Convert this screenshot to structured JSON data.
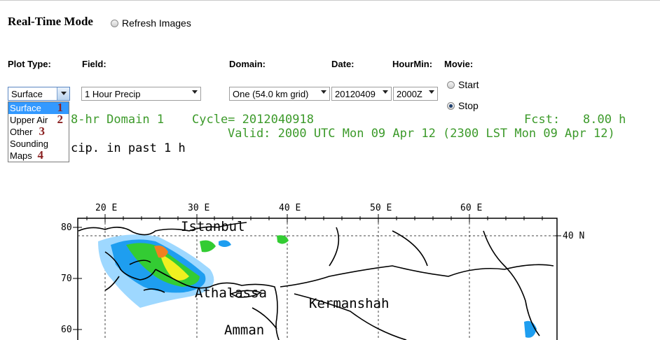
{
  "header": {
    "title": "Real-Time Mode",
    "refresh_label": "Refresh Images"
  },
  "labels": {
    "plot_type": "Plot Type:",
    "field": "Field:",
    "domain": "Domain:",
    "date": "Date:",
    "hourmin": "HourMin:",
    "movie": "Movie:"
  },
  "controls": {
    "plot_type": {
      "value": "Surface",
      "options": [
        "Surface",
        "Upper Air",
        "Other",
        "Sounding",
        "Maps"
      ],
      "numbers": [
        "1",
        "2",
        "3",
        "4"
      ]
    },
    "field": "1 Hour Precip",
    "domain": "One (54.0 km grid)",
    "date": "20120409",
    "hourmin": "2000Z",
    "movie": {
      "start": "Start",
      "stop": "Stop",
      "selected": "Stop"
    }
  },
  "plot": {
    "line1_left": "8-hr Domain 1",
    "line1_cycle": "Cycle= 2012040918",
    "line1_fcst": "Fcst:",
    "line1_fcst_val": "8.00 h",
    "line2": "Valid: 2000 UTC Mon 09 Apr 12 (2300 LST Mon 09 Apr 12)",
    "line3": "cip. in past 1 h"
  },
  "map": {
    "lon_labels": [
      "20 E",
      "30 E",
      "40 E",
      "50 E",
      "60 E"
    ],
    "lat_labels_left": [
      "80",
      "70",
      "60"
    ],
    "lat_label_right": "40 N",
    "cities": [
      "Istanbul",
      "Athalassa",
      "Kermanshah",
      "Amman"
    ]
  },
  "colors": {
    "precip_light": "#9ed8ff",
    "precip_mid": "#1e9ef0",
    "precip_green": "#33cc33",
    "precip_yellow": "#f0f020",
    "precip_orange": "#f08020",
    "text_green": "#3c9a2a"
  }
}
